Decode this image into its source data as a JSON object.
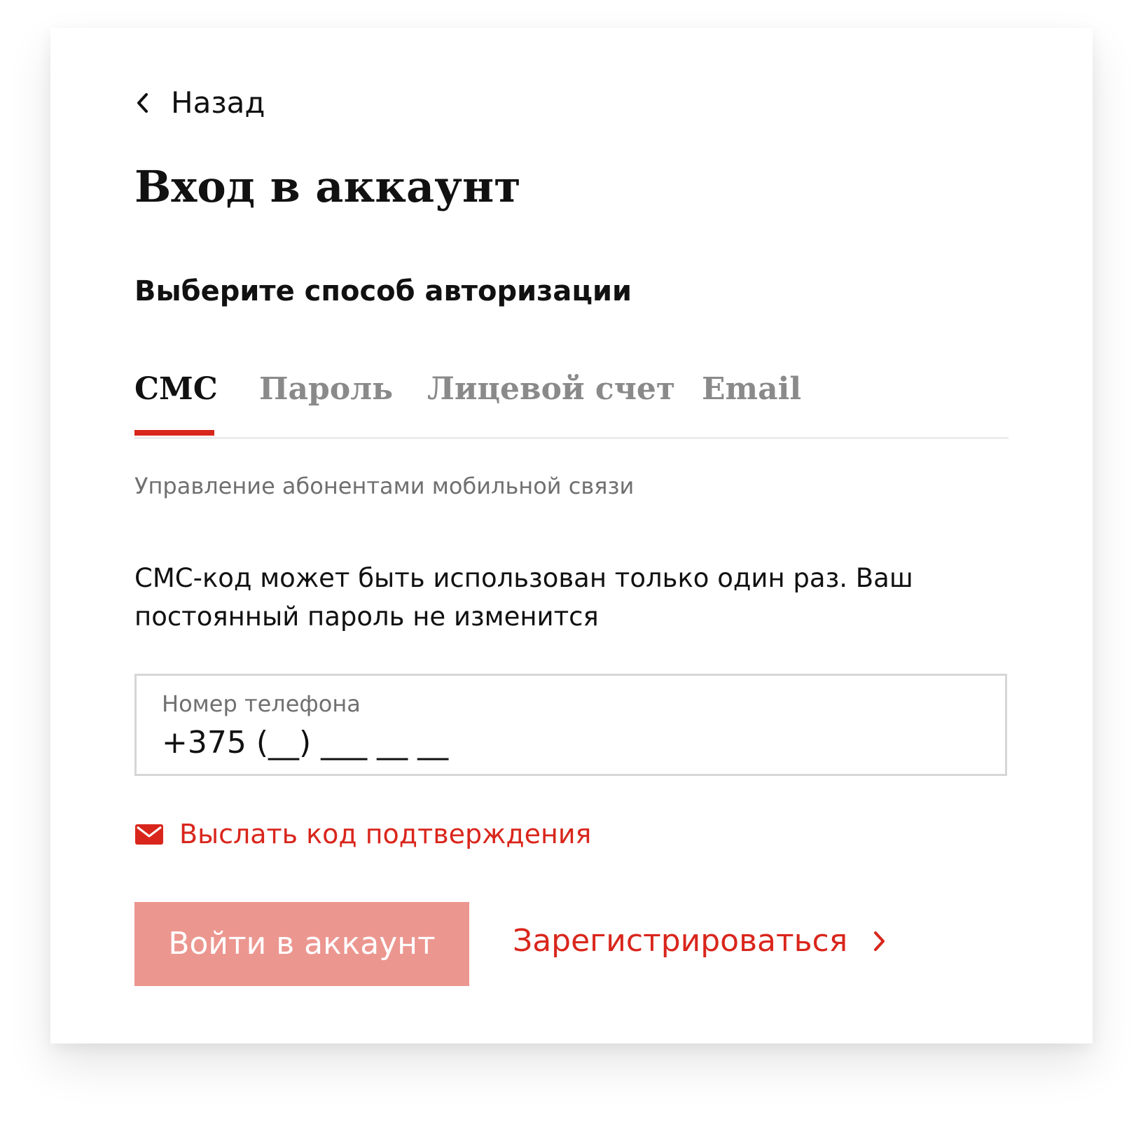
{
  "back": {
    "label": "Назад",
    "icon": "chevron-left-icon"
  },
  "title": "Вход в аккаунт",
  "subtitle": "Выберите способ авторизации",
  "tabs": [
    {
      "label": "СМС",
      "active": true
    },
    {
      "label": "Пароль",
      "active": false
    },
    {
      "label": "Лицевой счет",
      "active": false
    },
    {
      "label": "Email",
      "active": false
    }
  ],
  "hint": "Управление абонентами мобильной связи",
  "info_text": "СМС-код может быть использован только один раз. Ваш постоянный пароль не изменится",
  "phone_field": {
    "label": "Номер телефона",
    "value": "+375 (__) ___ __ __"
  },
  "send_code": {
    "label": "Выслать код подтверждения",
    "icon": "envelope-icon"
  },
  "login_button": {
    "label": "Войти в аккаунт"
  },
  "register_link": {
    "label": "Зарегистрироваться",
    "icon": "chevron-right-icon"
  },
  "colors": {
    "accent": "#d9261c",
    "button_disabled_bg": "#ec9690",
    "text_primary": "#111111",
    "text_secondary": "#707070",
    "tab_inactive": "#8a8a8a"
  }
}
